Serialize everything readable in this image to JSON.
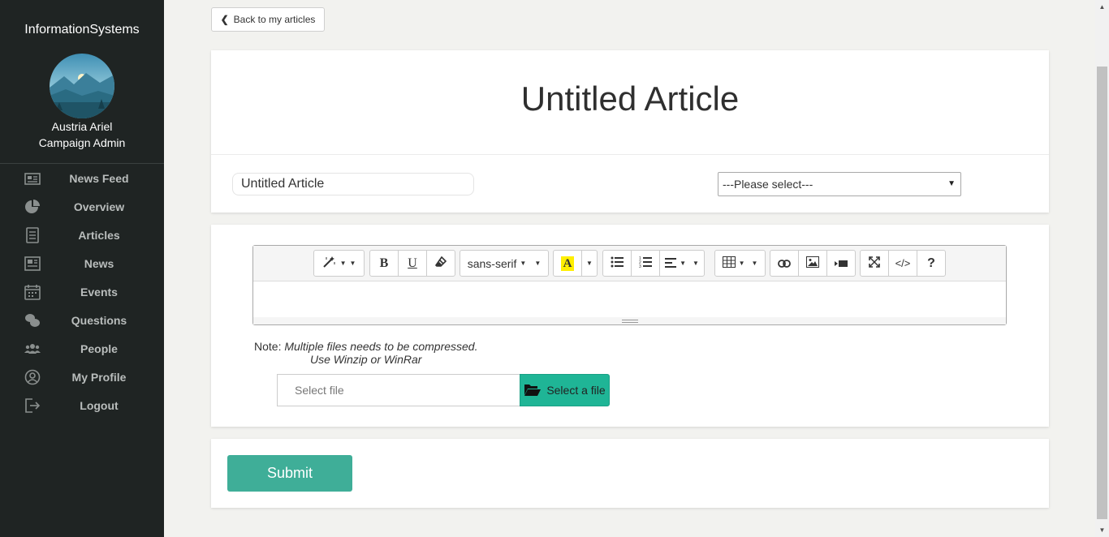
{
  "sidebar": {
    "brand": "InformationSystems",
    "user_name": "Austria Ariel",
    "user_role": "Campaign Admin",
    "items": [
      {
        "label": "News Feed",
        "icon": "newspaper-icon"
      },
      {
        "label": "Overview",
        "icon": "pie-chart-icon"
      },
      {
        "label": "Articles",
        "icon": "document-icon"
      },
      {
        "label": "News",
        "icon": "news-icon"
      },
      {
        "label": "Events",
        "icon": "calendar-icon"
      },
      {
        "label": "Questions",
        "icon": "chat-bubbles-icon"
      },
      {
        "label": "People",
        "icon": "users-icon"
      },
      {
        "label": "My Profile",
        "icon": "user-circle-icon"
      },
      {
        "label": "Logout",
        "icon": "logout-icon"
      }
    ]
  },
  "main": {
    "back_label": "Back to my articles",
    "title": "Untitled Article",
    "title_input_value": "Untitled Article",
    "category_select": "---Please select---",
    "toolbar": {
      "font_name": "sans-serif",
      "help_label": "?"
    },
    "note_prefix": "Note:",
    "note_line1": "Multiple files needs to be compressed.",
    "note_line2": "Use Winzip or WinRar",
    "file_placeholder": "Select file",
    "file_button": "Select a file",
    "submit_label": "Submit"
  },
  "colors": {
    "sidebar_bg": "#1f2423",
    "accent": "#3fae98",
    "file_button": "#1fb596"
  }
}
